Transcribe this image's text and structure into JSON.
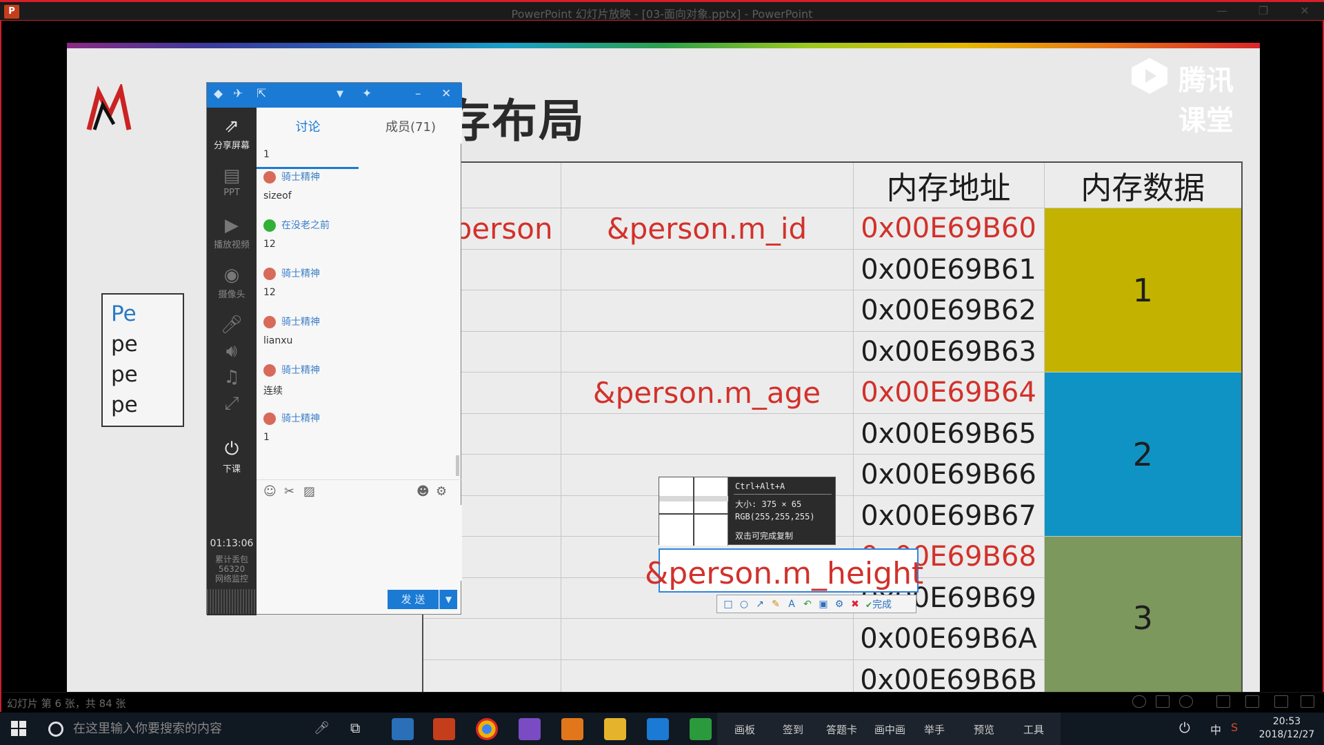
{
  "window": {
    "title": "PowerPoint 幻灯片放映 - [03-面向对象.pptx] - PowerPoint",
    "app_icon": "P",
    "controls": [
      "—",
      "❐",
      "✕"
    ]
  },
  "slide": {
    "title": "内存布局",
    "brand": "腾讯课堂",
    "code_lines": [
      "Pe",
      "pe",
      "pe",
      "pe"
    ],
    "table": {
      "headers": [
        "",
        "",
        "内存地址",
        "内存数据"
      ],
      "col1": [
        "&person"
      ],
      "col2": [
        "&person.m_id",
        "&person.m_age",
        "&person.m_height"
      ],
      "addresses": [
        "0x00E69B60",
        "0x00E69B61",
        "0x00E69B62",
        "0x00E69B63",
        "0x00E69B64",
        "0x00E69B65",
        "0x00E69B66",
        "0x00E69B67",
        "0x00E69B68",
        "0x00E69B69",
        "0x00E69B6A",
        "0x00E69B6B"
      ],
      "data_values": [
        "1",
        "2",
        "3"
      ],
      "colors": {
        "group1": "#c3b300",
        "group2": "#0f93c4",
        "group3": "#7c985c",
        "address_highlight": "#d2312b"
      }
    }
  },
  "capture": {
    "selected_text": "&person.m_height",
    "shortcut": "Ctrl+Alt+A",
    "size": "大小: 375 × 65",
    "rgb": "RGB(255,255,255)",
    "hint": "双击可完成复制",
    "tools": [
      "rect-icon",
      "ellipse-icon",
      "arrow-icon",
      "brush-icon",
      "text-icon",
      "undo-icon",
      "save-icon",
      "mosaic-icon",
      "cancel-icon"
    ],
    "done_label": "完成"
  },
  "panel": {
    "tabs": [
      "讨论",
      "成员(71)"
    ],
    "side": {
      "share": "分享屏幕",
      "ppt": "PPT",
      "video": "播放视频",
      "camera": "摄像头",
      "end": "下课"
    },
    "timer": "01:13:06",
    "stats": [
      "累计丢包",
      "56320",
      "网络监控"
    ],
    "messages": [
      {
        "name": "",
        "text": "1"
      },
      {
        "name": "骑士精神",
        "text": "sizeof"
      },
      {
        "name": "在没老之前",
        "text": "12"
      },
      {
        "name": "骑士精神",
        "text": "12"
      },
      {
        "name": "骑士精神",
        "text": "lianxu"
      },
      {
        "name": "骑士精神",
        "text": "连续"
      },
      {
        "name": "骑士精神",
        "text": "1"
      }
    ],
    "send_label": "发 送"
  },
  "statusbar": {
    "text": "幻灯片 第 6 张，共 84 张"
  },
  "taskbar": {
    "search_placeholder": "在这里输入你要搜索的内容",
    "class_tools": [
      "画板",
      "签到",
      "答题卡",
      "画中画",
      "举手",
      "预览",
      "工具"
    ],
    "ime": "中",
    "time": "20:53",
    "date": "2018/12/27"
  }
}
